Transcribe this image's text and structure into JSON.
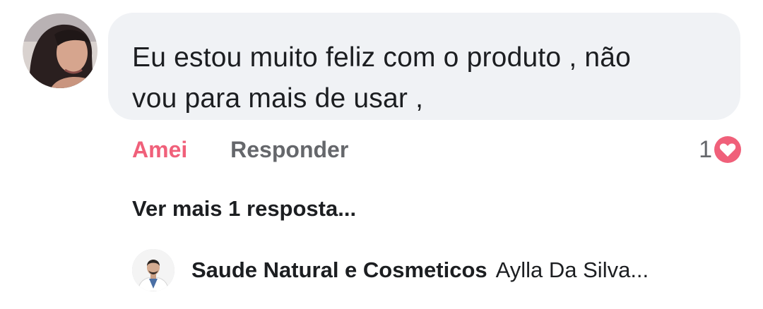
{
  "comment": {
    "avatar_icon": "user-profile-photo",
    "text_line1": "Eu estou muito feliz com o produto , não",
    "text_line2": "vou para mais de usar ,",
    "bubble_color": "#f0f2f5"
  },
  "actions": {
    "love_label": "Amei",
    "love_color": "#f0607a",
    "reply_label": "Responder"
  },
  "reactions": {
    "count": "1",
    "icon": "heart-icon",
    "color": "#f0607a"
  },
  "replies": {
    "more_label": "Ver mais 1 resposta...",
    "preview": {
      "avatar_icon": "page-profile-photo",
      "author": "Saude Natural e Cosmeticos",
      "snippet": "Aylla Da Silva..."
    }
  }
}
